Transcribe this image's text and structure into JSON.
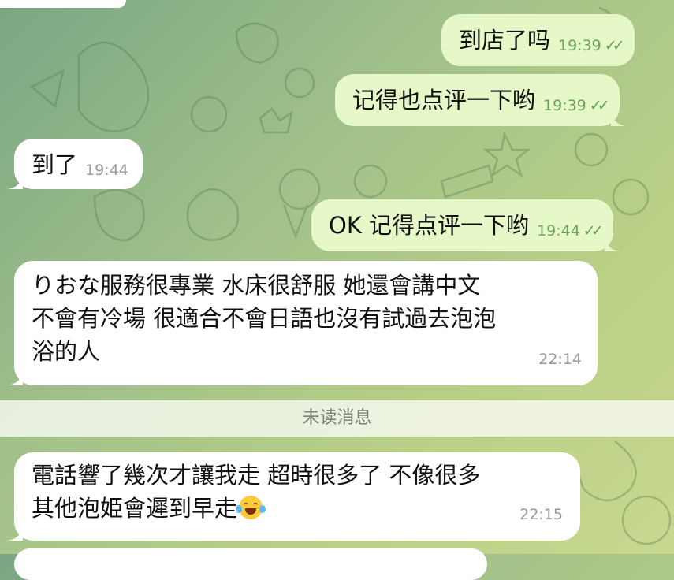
{
  "messages": [
    {
      "direction": "out",
      "text": "到店了吗",
      "time": "19:39",
      "ticks": "✓✓"
    },
    {
      "direction": "out",
      "text": "记得也点评一下哟",
      "time": "19:39",
      "ticks": "✓✓"
    },
    {
      "direction": "in",
      "text": "到了",
      "time": "19:44"
    },
    {
      "direction": "out",
      "text": "OK  记得点评一下哟",
      "time": "19:44",
      "ticks": "✓✓"
    },
    {
      "direction": "in",
      "lines": [
        "りおな服務很專業 水床很舒服 她還會講中文",
        "不會有冷場 很適合不會日語也沒有試過去泡泡",
        "浴的人"
      ],
      "time": "22:14"
    },
    {
      "direction": "in",
      "lines": [
        "電話響了幾次才讓我走 超時很多了 不像很多",
        "其他泡姫會遲到早走"
      ],
      "emoji": "laughing-with-tears",
      "time": "22:15"
    }
  ],
  "unread_divider": "未读消息",
  "colors": {
    "outgoing_bubble": "#e7f8c8",
    "incoming_bubble": "#ffffff",
    "read_ticks": "#62a34f"
  }
}
